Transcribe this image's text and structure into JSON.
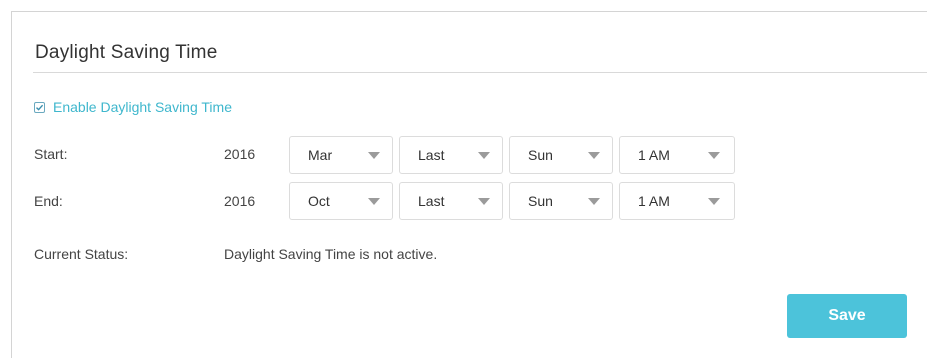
{
  "section": {
    "title": "Daylight Saving Time"
  },
  "enable": {
    "label": "Enable Daylight Saving Time",
    "checked": true
  },
  "start": {
    "label": "Start:",
    "year": "2016",
    "month": "Mar",
    "week": "Last",
    "day": "Sun",
    "time": "1 AM"
  },
  "end": {
    "label": "End:",
    "year": "2016",
    "month": "Oct",
    "week": "Last",
    "day": "Sun",
    "time": "1 AM"
  },
  "status": {
    "label": "Current Status:",
    "value": "Daylight Saving Time is not active."
  },
  "actions": {
    "save_label": "Save"
  },
  "colors": {
    "accent": "#4cc3da",
    "link": "#3fb7cd"
  },
  "icons": {
    "checkbox": "checkmark-icon",
    "dropdown": "caret-down-icon"
  }
}
